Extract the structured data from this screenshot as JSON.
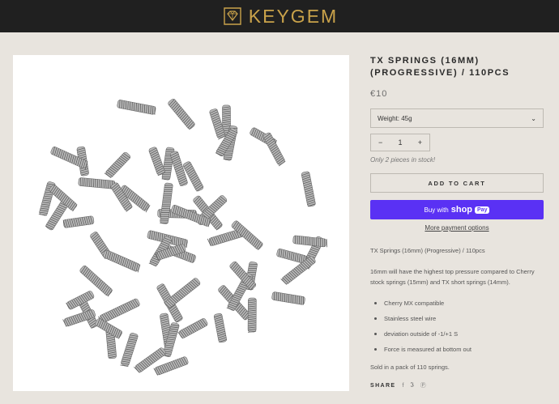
{
  "brand": {
    "name": "KEYGEM",
    "logo_icon": "gem-icon"
  },
  "colors": {
    "topbar": "#202020",
    "brand_gold": "#c9a24a",
    "background": "#e8e4de",
    "shop_pay": "#5a31f4"
  },
  "product": {
    "title": "TX SPRINGS (16MM) (PROGRESSIVE) / 110PCS",
    "price": "€10",
    "variant_selected": "Weight: 45g",
    "quantity": "1",
    "stock": "Only 2 pieces in stock!",
    "add_to_cart": "ADD TO CART",
    "buy_with": "Buy with",
    "shop": "shop",
    "pay": "Pay",
    "more_payment": "More payment options"
  },
  "description": {
    "p1": "TX Springs (16mm) (Progressive) / 110pcs",
    "p2": "16mm will have the highest top pressure compared to Cherry stock springs (15mm) and TX short springs (14mm).",
    "bullets": [
      "Cherry MX compatible",
      "Stainless steel wire",
      "deviation outside of -1/+1 S",
      "Force is measured at bottom out"
    ],
    "p3": "Sold in a pack of 110 springs."
  },
  "share": {
    "label": "SHARE",
    "icons": [
      "facebook-icon",
      "twitter-icon",
      "pinterest-icon"
    ]
  }
}
